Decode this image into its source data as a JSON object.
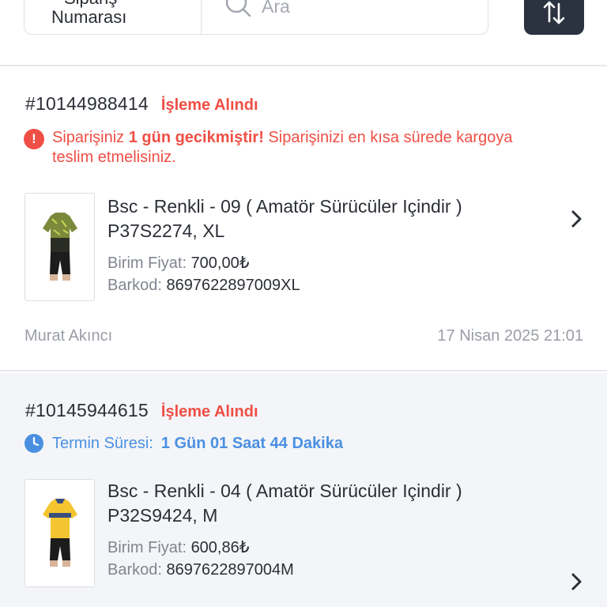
{
  "search": {
    "filter_line1": "Sipariş",
    "filter_line2": "Numarası",
    "placeholder": "Ara"
  },
  "colors": {
    "accent_dark": "#2c3340",
    "status_red": "#ef4f45",
    "info_blue": "#4a90e2",
    "muted": "#9a9ea6"
  },
  "orders": [
    {
      "number": "#10144988414",
      "status": "İşleme Alındı",
      "alert": {
        "prefix": "Siparişiniz ",
        "bold": "1 gün gecikmiştir!",
        "suffix": " Siparişinizi en kısa sürede kargoya teslim etmelisiniz."
      },
      "product": {
        "title_line1": "Bsc - Renkli - 09 ( Amatör Sürücüler Içindir )",
        "title_line2": "P37S2274, XL",
        "price_label": "Birim Fiyat:",
        "price": "700,00₺",
        "barcode_label": "Barkod:",
        "barcode": "8697622897009XL"
      },
      "customer": "Murat Akıncı",
      "date": "17 Nisan 2025 21:01"
    },
    {
      "number": "#10145944615",
      "status": "İşleme Alındı",
      "deadline": {
        "label": "Termin Süresi:",
        "value": "1 Gün 01 Saat 44 Dakika"
      },
      "product": {
        "title_line1": "Bsc - Renkli - 04 ( Amatör Sürücüler Içindir )",
        "title_line2": "P32S9424, M",
        "price_label": "Birim Fiyat:",
        "price": "600,86₺",
        "barcode_label": "Barkod:",
        "barcode": "8697622897004M"
      }
    }
  ]
}
